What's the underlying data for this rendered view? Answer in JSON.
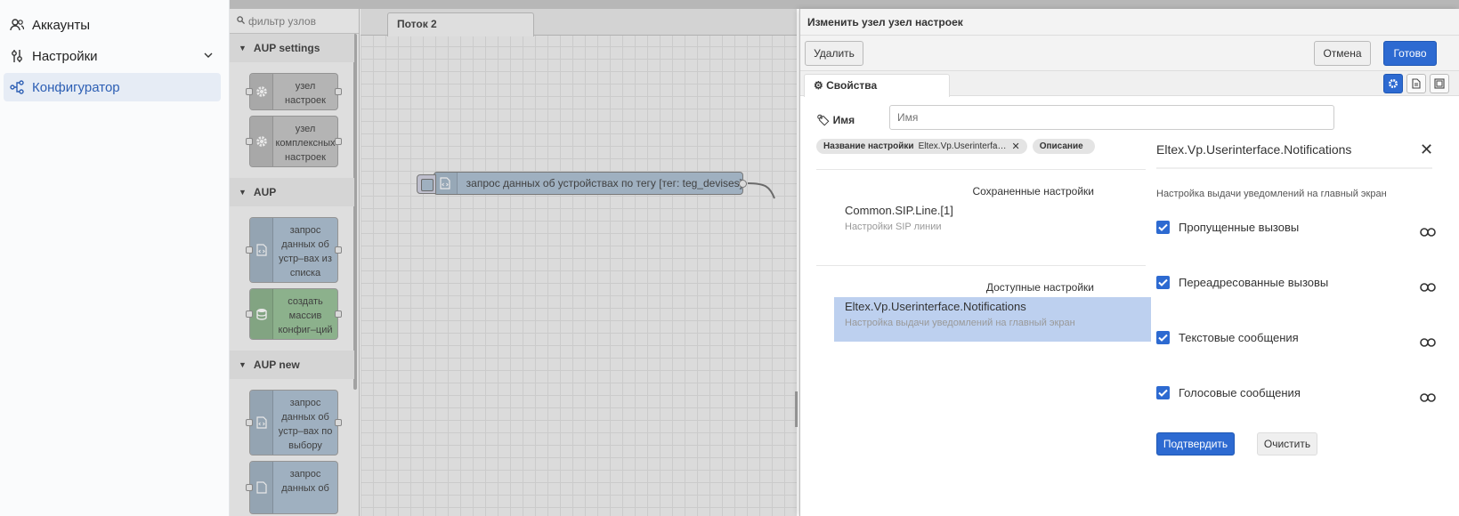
{
  "sidebar": {
    "items": [
      {
        "label": "Аккаунты"
      },
      {
        "label": "Настройки"
      },
      {
        "label": "Конфигуратор"
      }
    ]
  },
  "palette": {
    "search_placeholder": "фильтр узлов",
    "categories": [
      {
        "name": "AUP settings",
        "nodes": [
          "узел настроек",
          "узел комплексных настроек"
        ]
      },
      {
        "name": "AUP",
        "nodes": [
          "запрос данных об устр–вах из списка",
          "создать массив конфиг–ций"
        ]
      },
      {
        "name": "AUP new",
        "nodes": [
          "запрос данных об устр–вах по выбору",
          "запрос данных об"
        ]
      }
    ]
  },
  "workspace": {
    "tab": "Поток 2",
    "node_label": "запрос данных об устройствах по тегу [тег: teg_devises]"
  },
  "tray": {
    "title": "Изменить узел узел настроек",
    "delete": "Удалить",
    "cancel": "Отмена",
    "done": "Готово",
    "tab_properties": "Свойства",
    "name_label": "Имя",
    "name_placeholder": "Имя",
    "filter_name_key": "Название настройки",
    "filter_name_value": "Eltex.Vp.Userinterfa…",
    "filter_description": "Описание",
    "saved_title": "Сохраненные настройки",
    "saved": [
      {
        "title": "Common.SIP.Line.[1]",
        "desc": "Настройки SIP линии"
      }
    ],
    "available_title": "Доступные настройки",
    "available": [
      {
        "title": "Eltex.Vp.Userinterface.Notifications",
        "desc": "Настройка выдачи уведомлений на главный экран"
      }
    ],
    "detail": {
      "title": "Eltex.Vp.Userinterface.Notifications",
      "desc": "Настройка выдачи уведомлений на главный экран",
      "options": [
        {
          "label": "Пропущенные вызовы",
          "checked": true
        },
        {
          "label": "Переадресованные вызовы",
          "checked": true
        },
        {
          "label": "Текстовые сообщения",
          "checked": true
        },
        {
          "label": "Голосовые сообщения",
          "checked": true
        }
      ],
      "confirm": "Подтвердить",
      "clear": "Очистить"
    }
  },
  "colors": {
    "accent": "#2d6ad1",
    "active_nav": "#2d5fb4",
    "selected_row": "#bdd0ef"
  }
}
